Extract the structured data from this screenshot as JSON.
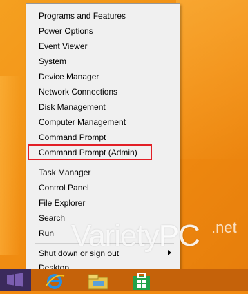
{
  "menu": {
    "items": [
      "Programs and Features",
      "Power Options",
      "Event Viewer",
      "System",
      "Device Manager",
      "Network Connections",
      "Disk Management",
      "Computer Management",
      "Command Prompt",
      "Command Prompt (Admin)",
      "Task Manager",
      "Control Panel",
      "File Explorer",
      "Search",
      "Run",
      "Shut down or sign out",
      "Desktop"
    ]
  },
  "watermark": {
    "main": "Variety",
    "accent": "PC",
    "suffix": ".net"
  },
  "colors": {
    "highlight_border": "#e21f26",
    "menu_background": "#f0f0f0",
    "desktop_background": "#f28a10"
  },
  "taskbar": {
    "icons": [
      "windows-start-icon",
      "internet-explorer-icon",
      "file-explorer-icon",
      "store-icon"
    ]
  }
}
